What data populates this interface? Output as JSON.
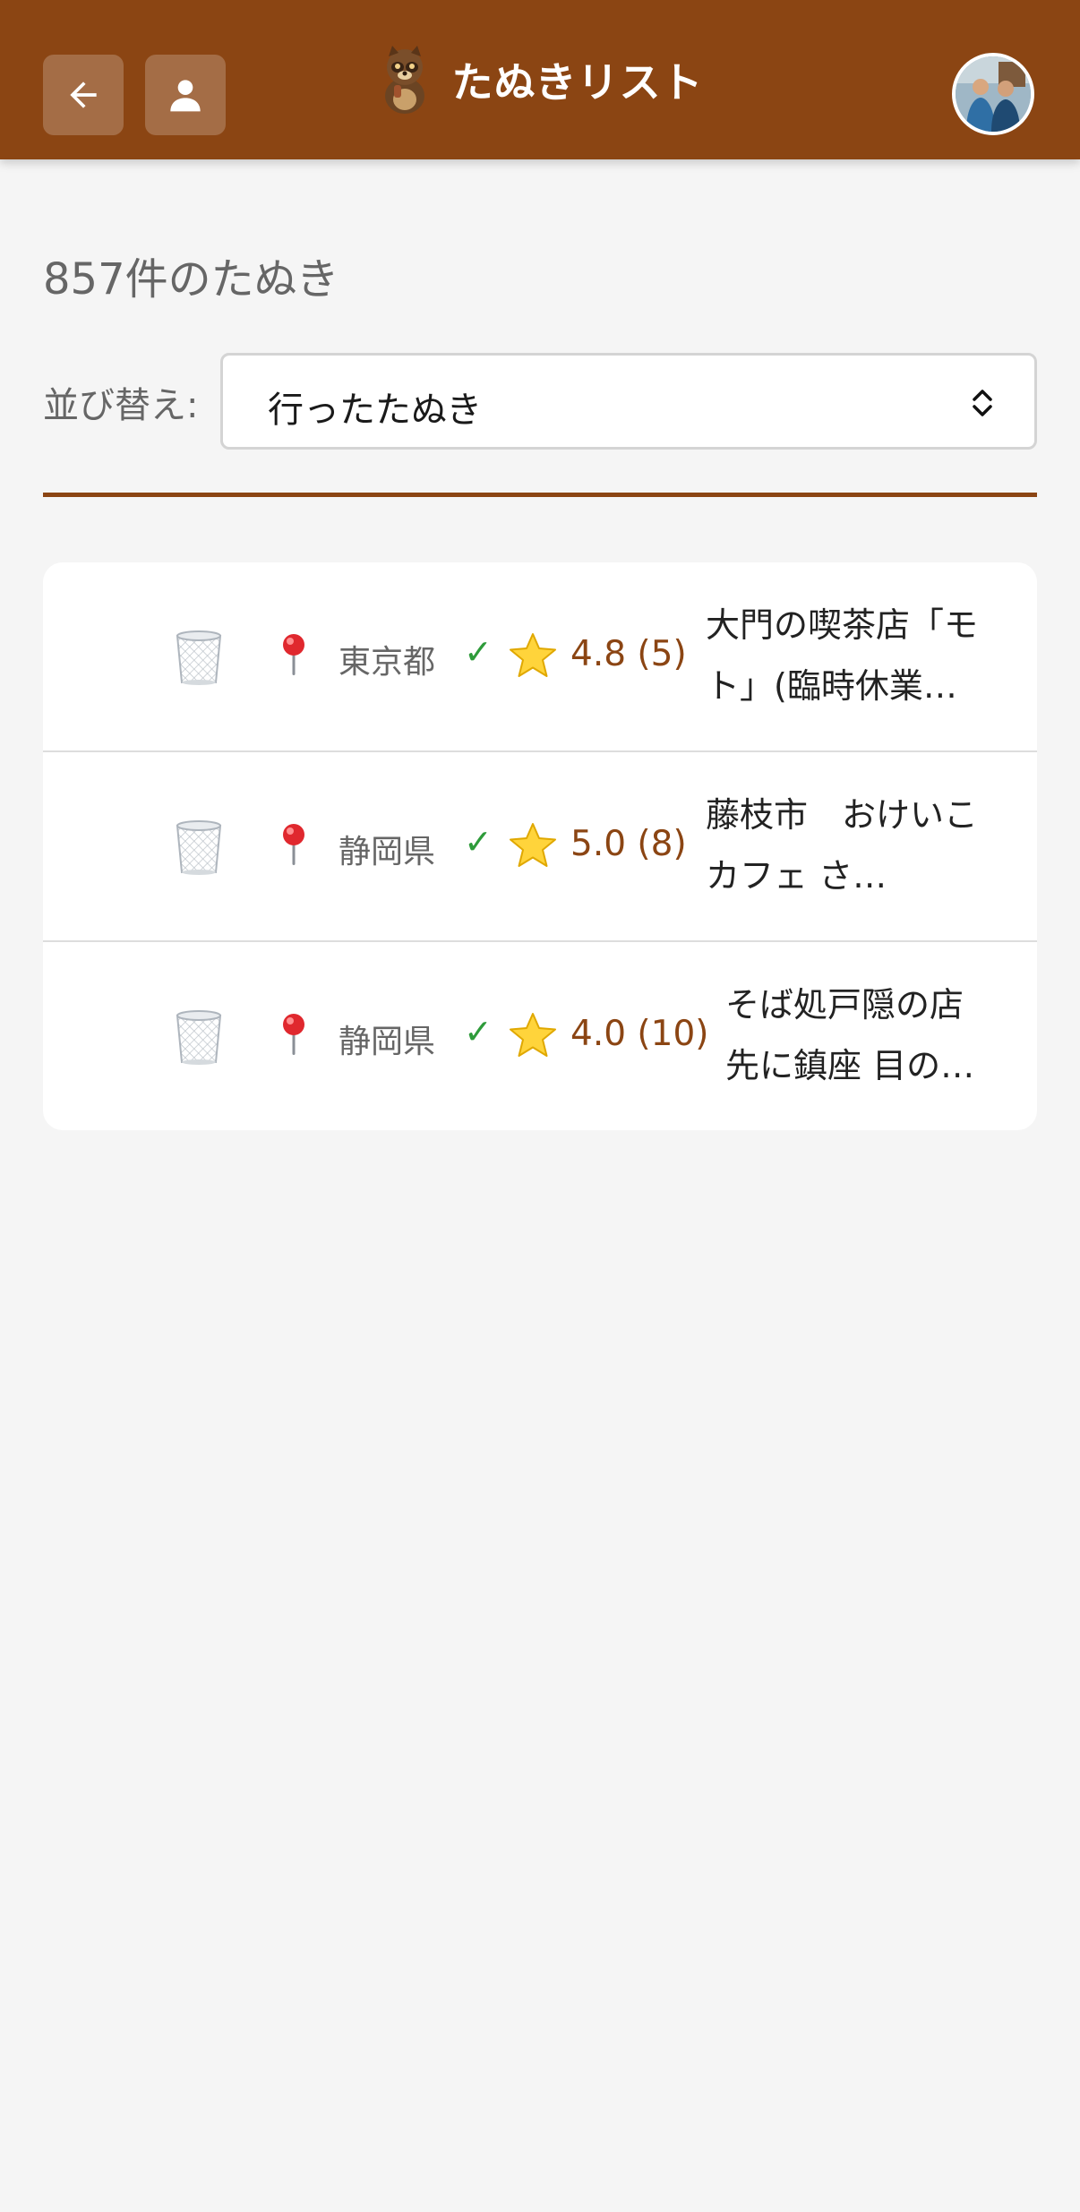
{
  "header": {
    "title": "たぬきリスト",
    "back_icon": "arrow-left-icon",
    "user_icon": "person-icon",
    "logo_icon": "tanuki-icon",
    "avatar_icon": "user-avatar-photo",
    "bg_color": "#8b4513"
  },
  "summary": {
    "count_text": "857件のたぬき"
  },
  "sort": {
    "label": "並び替え:",
    "selected": "行ったたぬき",
    "icon": "select-updown-icon"
  },
  "items": [
    {
      "trash_icon": "trash-icon",
      "pin_icon": "pin-icon",
      "prefecture": "東京都",
      "check": "✓",
      "star_icon": "star-icon",
      "rating": "4.8 (5)",
      "name_line1": "大門の喫茶店「モ",
      "name_line2": "ト」(臨時休業…"
    },
    {
      "trash_icon": "trash-icon",
      "pin_icon": "pin-icon",
      "prefecture": "静岡県",
      "check": "✓",
      "star_icon": "star-icon",
      "rating": "5.0 (8)",
      "name_line1": "藤枝市　おけいこ",
      "name_line2": "カフェ さ…"
    },
    {
      "trash_icon": "trash-icon",
      "pin_icon": "pin-icon",
      "prefecture": "静岡県",
      "check": "✓",
      "star_icon": "star-icon",
      "rating": "4.0 (10)",
      "name_line1": "そば処戸隠の店",
      "name_line2": "先に鎮座 目の…"
    }
  ],
  "colors": {
    "accent": "#8b4513",
    "check": "#2e9b3a",
    "background": "#f5f5f5"
  }
}
